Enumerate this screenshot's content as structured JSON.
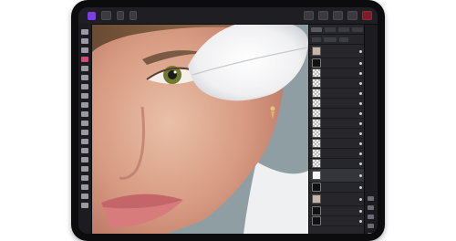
{
  "app": {
    "logo_icon": "affinity-photo-logo",
    "accent_color": "#7b3fe4"
  },
  "topbar": {
    "left_buttons": [
      "document-menu-icon",
      "persona-icon",
      "grid-icon",
      "view-icon"
    ],
    "right_buttons": [
      "undo-icon",
      "redo-icon",
      "share-icon",
      "settings-icon",
      "help-icon"
    ]
  },
  "tools": [
    "move-icon",
    "selection-icon",
    "crop-icon",
    "paint-brush-icon",
    "erase-icon",
    "fill-icon",
    "gradient-icon",
    "clone-icon",
    "healing-icon",
    "red-eye-icon",
    "dodge-icon",
    "burn-icon",
    "sponge-icon",
    "smudge-icon",
    "blur-icon",
    "pen-icon",
    "shape-icon",
    "text-icon",
    "zoom-icon",
    "hand-icon"
  ],
  "studio": {
    "tabs": [
      "layers-tab-icon",
      "adjustments-tab-icon",
      "effects-tab-icon",
      "styles-tab-icon"
    ],
    "layers": [
      {
        "thumb": "photo",
        "label": "",
        "visible": true
      },
      {
        "thumb": "mask",
        "label": "",
        "visible": true
      },
      {
        "thumb": "checker",
        "label": "",
        "visible": true
      },
      {
        "thumb": "checker",
        "label": "",
        "visible": true
      },
      {
        "thumb": "checker",
        "label": "",
        "visible": true
      },
      {
        "thumb": "checker",
        "label": "",
        "visible": true
      },
      {
        "thumb": "checker",
        "label": "",
        "visible": true
      },
      {
        "thumb": "checker",
        "label": "",
        "visible": true
      },
      {
        "thumb": "checker",
        "label": "",
        "visible": true
      },
      {
        "thumb": "checker",
        "label": "",
        "visible": true
      },
      {
        "thumb": "checker",
        "label": "",
        "visible": true
      },
      {
        "thumb": "checker",
        "label": "",
        "visible": true
      },
      {
        "thumb": "white",
        "label": "",
        "visible": true
      },
      {
        "thumb": "mask",
        "label": "",
        "visible": true
      },
      {
        "thumb": "photo",
        "label": "",
        "visible": true
      },
      {
        "thumb": "mask",
        "label": "",
        "visible": true
      },
      {
        "thumb": "mask",
        "label": "",
        "visible": true
      }
    ]
  },
  "right_tools": [
    "navigator-icon",
    "history-icon",
    "channels-icon",
    "brushes-icon",
    "color-icon",
    "swatches-icon"
  ]
}
